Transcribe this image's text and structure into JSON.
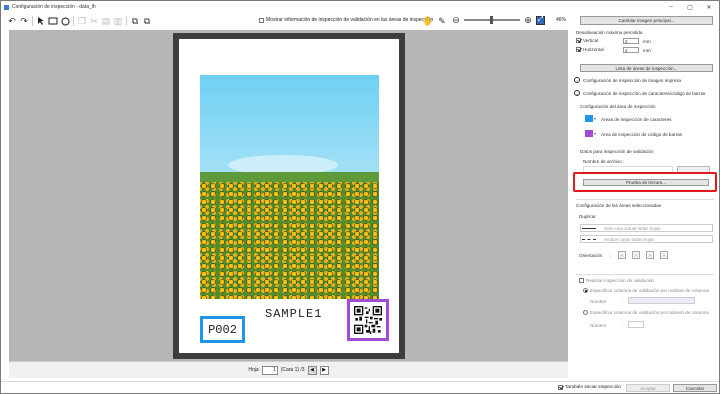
{
  "window": {
    "title": "Configuración de inspección - data_lh",
    "controls": [
      "minimize",
      "maximize",
      "close"
    ]
  },
  "toolbar": {
    "icons": [
      "undo-icon",
      "redo-icon",
      "pointer-icon",
      "rectangle-icon",
      "circle-icon",
      "copy-icon",
      "cut-icon",
      "paste-icon",
      "delete-icon",
      "bring-forward-icon",
      "send-backward-icon"
    ],
    "show_validation_label": "Mostrar información de inspección de validación en las áreas de inspección",
    "zoom_value": "46%"
  },
  "document": {
    "sample_text": "SAMPLE1",
    "char_area_text": "P002"
  },
  "colors": {
    "char_area": "#2196e6",
    "barcode_area": "#a24bd4",
    "highlight": "#e01b1b"
  },
  "pager": {
    "label": "Hoja",
    "current": "1",
    "faces": "(Cara 1) /3"
  },
  "panel": {
    "change_image_btn": "Cambiar imagen principal...",
    "max_offset": {
      "title": "Desalineación máxima permitida",
      "vertical_label": "Vertical",
      "vertical_value": "2",
      "vertical_unit": "mm",
      "horizontal_label": "Horizontal",
      "horizontal_value": "2",
      "horizontal_unit": "mm"
    },
    "list_areas_btn": "Lista de áreas de inspección...",
    "section_print": "Configuración de inspección de imagen impresa",
    "section_char_code": "Configuración de inspección de caracteres/código de barras",
    "area_config_title": "Configuración del área de inspección",
    "char_area_label": "Áreas de inspección de caracteres",
    "barcode_area_label": "Área de inspección de código de barras",
    "validation_data_title": "Datos para inspección de validación",
    "file_name_label": "Nombre de archivo :",
    "reading_test_btn": "Prueba de lectura...",
    "selected_areas_title": "Configuración de las áreas seleccionadas",
    "duplicate_label": "Duplicar",
    "dup_option1": "Solo cara actual todas hojas",
    "dup_option2": "Ambas caras todas hojas",
    "orientation_label": "Orientación",
    "orientation_buttons": [
      "A",
      "A",
      "A",
      "A"
    ],
    "perform_validation_label": "Realizar inspección de validación",
    "by_name_label": "Especificar columna de validación por nombre de columna",
    "name_label": "Nombre",
    "by_number_label": "Especificar columna de validación por número de columna",
    "number_label": "Número"
  },
  "footer": {
    "also_start_label": "También iniciar inspección",
    "apply_btn": "Aceptar",
    "cancel_btn": "Cancelar"
  }
}
